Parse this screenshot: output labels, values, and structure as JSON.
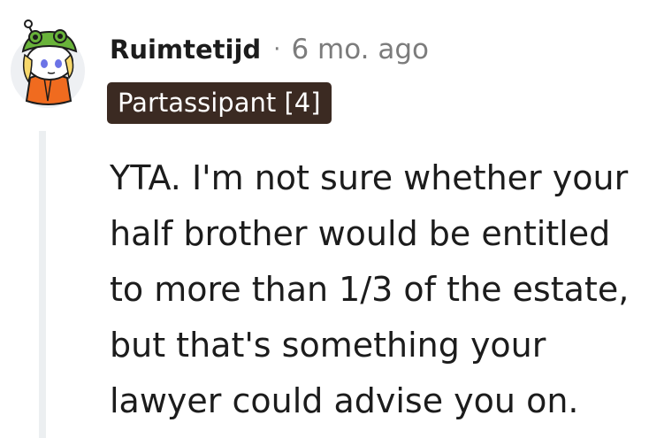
{
  "comment": {
    "username": "Ruimtetijd",
    "separator": "·",
    "timestamp": "6 mo. ago",
    "flair": "Partassipant [4]",
    "avatar_icon": "snoo-avatar-frog-hat-icon",
    "body_lines": [
      "YTA. I'm not sure whether your",
      "half brother would be entitled",
      "to more than 1/3 of the estate,",
      "but that's something your",
      "lawyer could advise you on."
    ]
  },
  "colors": {
    "text": "#1c1c1c",
    "meta": "#7c7c7c",
    "flair_bg": "#3b2a22",
    "flair_text": "#ffffff",
    "thread_line": "#eceff1"
  }
}
